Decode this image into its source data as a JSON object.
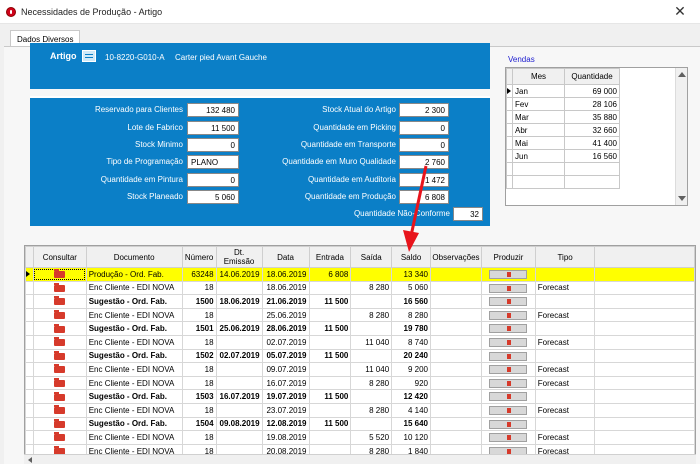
{
  "window": {
    "title": "Necessidades de Produção - Artigo",
    "close_glyph": "✕"
  },
  "tabs": [
    {
      "label": "Dados Diversos"
    }
  ],
  "artigo": {
    "label": "Artigo",
    "code": "10-8220-G010-A",
    "description": "Carter pied Avant Gauche"
  },
  "left_fields": [
    {
      "label": "Reservado para Clientes",
      "value": "132 480"
    },
    {
      "label": "Lote de Fabrico",
      "value": "11 500"
    },
    {
      "label": "Stock Minimo",
      "value": "0"
    },
    {
      "label": "Tipo de Programação",
      "value": "PLANO"
    },
    {
      "label": "Quantidade em Pintura",
      "value": "0"
    },
    {
      "label": "Stock Planeado",
      "value": "5 060"
    }
  ],
  "right_fields": [
    {
      "label": "Stock Atual do Artigo",
      "value": "2 300"
    },
    {
      "label": "Quantidade em Picking",
      "value": "0"
    },
    {
      "label": "Quantidade em Transporte",
      "value": "0"
    },
    {
      "label": "Quantidade em Muro Qualidade",
      "value": "2 760"
    },
    {
      "label": "Quantidade em Auditoria",
      "value": "1 472"
    },
    {
      "label": "Quantidade em Produção",
      "value": "6 808"
    },
    {
      "label": "Quantidade Não-Conforme",
      "value": "32"
    }
  ],
  "vendas": {
    "title": "Vendas",
    "headers": [
      "Mes",
      "Quantidade"
    ],
    "rows": [
      {
        "mes": "Jan",
        "qtd": "69 000"
      },
      {
        "mes": "Fev",
        "qtd": "28 106"
      },
      {
        "mes": "Mar",
        "qtd": "35 880"
      },
      {
        "mes": "Abr",
        "qtd": "32 660"
      },
      {
        "mes": "Mai",
        "qtd": "41 400"
      },
      {
        "mes": "Jun",
        "qtd": "16 560"
      }
    ]
  },
  "grid": {
    "headers": [
      "Consultar",
      "Documento",
      "Número",
      "Dt. Emissão",
      "Data",
      "Entrada",
      "Saída",
      "Saldo",
      "Observações",
      "Produzir",
      "Tipo"
    ],
    "rows": [
      {
        "doc": "Produção - Ord. Fab.",
        "num": "63248",
        "emissao": "14.06.2019",
        "data": "18.06.2019",
        "entrada": "6 808",
        "saida": "",
        "saldo": "13 340",
        "tipo": "",
        "style": "hl"
      },
      {
        "doc": "Enc Cliente - EDI NOVA",
        "num": "18",
        "emissao": "",
        "data": "18.06.2019",
        "entrada": "",
        "saida": "8 280",
        "saldo": "5 060",
        "tipo": "Forecast",
        "style": ""
      },
      {
        "doc": "Sugestão - Ord. Fab.",
        "num": "1500",
        "emissao": "18.06.2019",
        "data": "21.06.2019",
        "entrada": "11 500",
        "saida": "",
        "saldo": "16 560",
        "tipo": "",
        "style": "bold"
      },
      {
        "doc": "Enc Cliente - EDI NOVA",
        "num": "18",
        "emissao": "",
        "data": "25.06.2019",
        "entrada": "",
        "saida": "8 280",
        "saldo": "8 280",
        "tipo": "Forecast",
        "style": ""
      },
      {
        "doc": "Sugestão - Ord. Fab.",
        "num": "1501",
        "emissao": "25.06.2019",
        "data": "28.06.2019",
        "entrada": "11 500",
        "saida": "",
        "saldo": "19 780",
        "tipo": "",
        "style": "bold"
      },
      {
        "doc": "Enc Cliente - EDI NOVA",
        "num": "18",
        "emissao": "",
        "data": "02.07.2019",
        "entrada": "",
        "saida": "11 040",
        "saldo": "8 740",
        "tipo": "Forecast",
        "style": ""
      },
      {
        "doc": "Sugestão - Ord. Fab.",
        "num": "1502",
        "emissao": "02.07.2019",
        "data": "05.07.2019",
        "entrada": "11 500",
        "saida": "",
        "saldo": "20 240",
        "tipo": "",
        "style": "bold"
      },
      {
        "doc": "Enc Cliente - EDI NOVA",
        "num": "18",
        "emissao": "",
        "data": "09.07.2019",
        "entrada": "",
        "saida": "11 040",
        "saldo": "9 200",
        "tipo": "Forecast",
        "style": ""
      },
      {
        "doc": "Enc Cliente - EDI NOVA",
        "num": "18",
        "emissao": "",
        "data": "16.07.2019",
        "entrada": "",
        "saida": "8 280",
        "saldo": "920",
        "tipo": "Forecast",
        "style": ""
      },
      {
        "doc": "Sugestão - Ord. Fab.",
        "num": "1503",
        "emissao": "16.07.2019",
        "data": "19.07.2019",
        "entrada": "11 500",
        "saida": "",
        "saldo": "12 420",
        "tipo": "",
        "style": "bold"
      },
      {
        "doc": "Enc Cliente - EDI NOVA",
        "num": "18",
        "emissao": "",
        "data": "23.07.2019",
        "entrada": "",
        "saida": "8 280",
        "saldo": "4 140",
        "tipo": "Forecast",
        "style": ""
      },
      {
        "doc": "Sugestão - Ord. Fab.",
        "num": "1504",
        "emissao": "09.08.2019",
        "data": "12.08.2019",
        "entrada": "11 500",
        "saida": "",
        "saldo": "15 640",
        "tipo": "",
        "style": "bold"
      },
      {
        "doc": "Enc Cliente - EDI NOVA",
        "num": "18",
        "emissao": "",
        "data": "19.08.2019",
        "entrada": "",
        "saida": "5 520",
        "saldo": "10 120",
        "tipo": "Forecast",
        "style": ""
      },
      {
        "doc": "Enc Cliente - EDI NOVA",
        "num": "18",
        "emissao": "",
        "data": "20.08.2019",
        "entrada": "",
        "saida": "8 280",
        "saldo": "1 840",
        "tipo": "Forecast",
        "style": ""
      }
    ]
  },
  "colors": {
    "panel_blue": "#0b7fc7",
    "highlight_yellow": "#ffff00",
    "annotation_red": "#e8141c",
    "vendas_title": "#2020d0"
  }
}
